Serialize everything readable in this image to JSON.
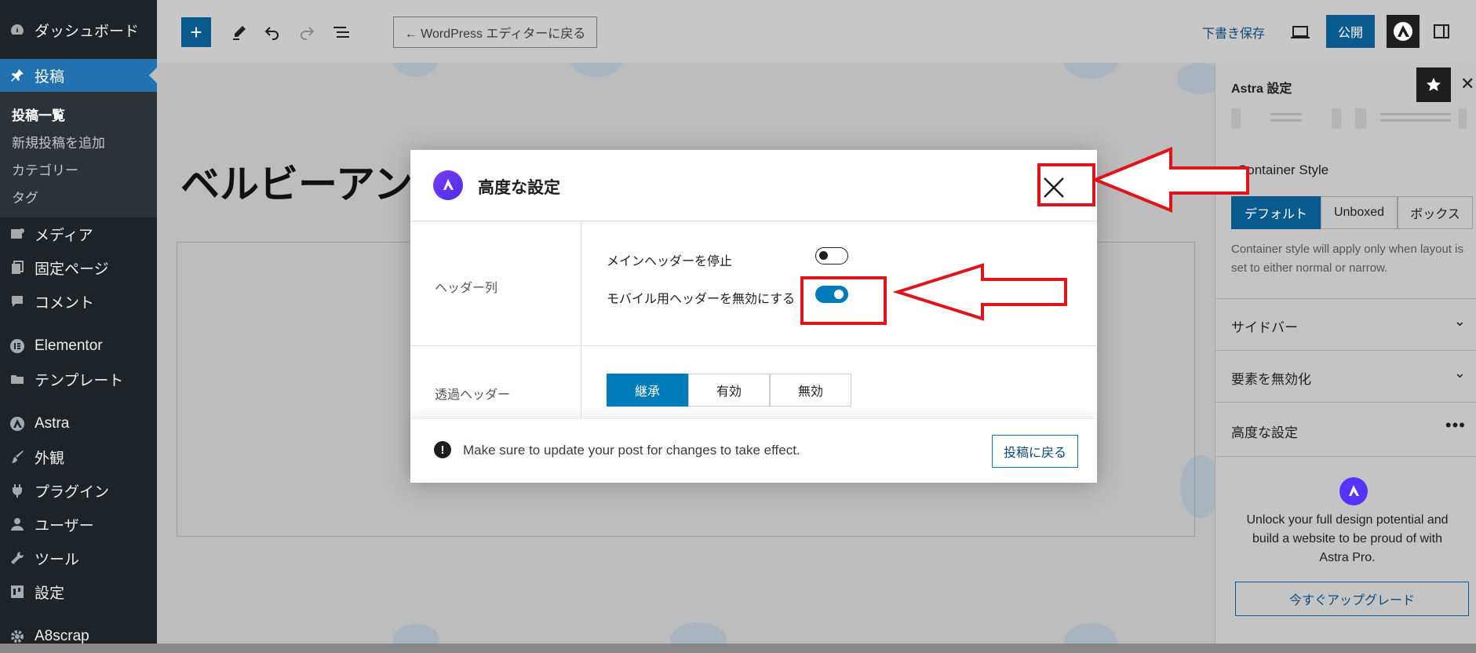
{
  "colors": {
    "admin_bg": "#1d2327",
    "accent": "#2271b1",
    "wp_blue": "#007cba",
    "astra_purple": "#5733ff",
    "annotation_red": "#e0141b"
  },
  "sidebar": {
    "items": [
      {
        "label": "ダッシュボード",
        "icon": "dashboard-icon"
      },
      {
        "label": "投稿",
        "icon": "pin-icon"
      },
      {
        "label": "メディア",
        "icon": "media-icon"
      },
      {
        "label": "固定ページ",
        "icon": "page-icon"
      },
      {
        "label": "コメント",
        "icon": "comment-icon"
      },
      {
        "label": "Elementor",
        "icon": "elementor-icon"
      },
      {
        "label": "テンプレート",
        "icon": "folder-icon"
      },
      {
        "label": "Astra",
        "icon": "astra-icon"
      },
      {
        "label": "外観",
        "icon": "brush-icon"
      },
      {
        "label": "プラグイン",
        "icon": "plugin-icon"
      },
      {
        "label": "ユーザー",
        "icon": "user-icon"
      },
      {
        "label": "ツール",
        "icon": "wrench-icon"
      },
      {
        "label": "設定",
        "icon": "settings-icon"
      },
      {
        "label": "A8scrap",
        "icon": "gear-icon"
      }
    ],
    "submenu": [
      "投稿一覧",
      "新規投稿を追加",
      "カテゴリー",
      "タグ"
    ]
  },
  "toolbar": {
    "back_label": "← WordPress エディターに戻る",
    "save_draft": "下書き保存",
    "publish": "公開"
  },
  "editor": {
    "title": "ベルビーアン"
  },
  "panel": {
    "title": "Astra 設定",
    "container_style_label": "Container Style",
    "container_options": [
      "デフォルト",
      "Unboxed",
      "ボックス"
    ],
    "container_help": "Container style will apply only when layout is set to either normal or narrow.",
    "sections": [
      "サイドバー",
      "要素を無効化",
      "高度な設定"
    ],
    "promo_text": "Unlock your full design potential and build a website to be proud of with Astra Pro.",
    "upgrade_button": "今すぐアップグレード"
  },
  "modal": {
    "title": "高度な設定",
    "header_row_label": "ヘッダー列",
    "toggle1_label": "メインヘッダーを停止",
    "toggle1_on": false,
    "toggle2_label": "モバイル用ヘッダーを無効にする",
    "toggle2_on": true,
    "transparent_label": "透過ヘッダー",
    "transparent_options": [
      "継承",
      "有効",
      "無効"
    ],
    "notice": "Make sure to update your post for changes to take effect.",
    "back_button": "投稿に戻る"
  }
}
